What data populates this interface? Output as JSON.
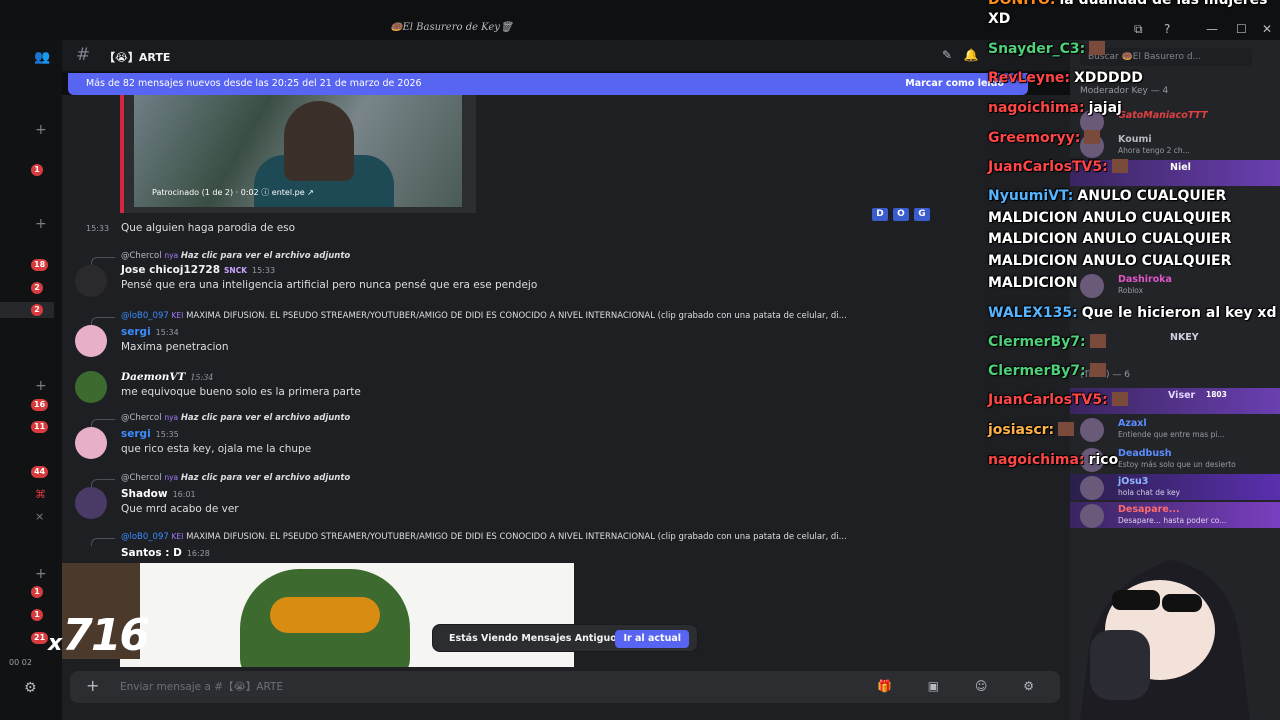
{
  "window": {
    "title": "🍩El Basurero de Key🗑",
    "controls": [
      "⧉",
      "?",
      "—",
      "☐",
      "✕"
    ]
  },
  "server_rail": {
    "badges": [
      "1",
      "18",
      "2",
      "2",
      "16",
      "11",
      "44",
      "1",
      "1",
      "21"
    ],
    "time_tag": "00  02"
  },
  "channel": {
    "name": "【😭】ARTE"
  },
  "new_messages_banner": {
    "text": "Más de 82 mensajes nuevos desde las 20:25 del 21 de marzo de 2026",
    "mark_read": "Marcar como leído"
  },
  "embed": {
    "caption": "Patrocinado (1 de 2) · 0:02  ⓘ  entel.pe ↗"
  },
  "hover_toolbar": [
    "D",
    "O",
    "G"
  ],
  "messages": [
    {
      "time": "15:33",
      "text": "Que alguien haga parodia de eso"
    },
    {
      "reply_name": "@Chercol",
      "reply_tag": "nya",
      "reply_text": "Haz clic para ver el archivo adjunto",
      "author": "Jose chicoj12728",
      "author_tag": "SNCK",
      "time": "15:33",
      "text": "Pensé que era una inteligencia artificial pero nunca pensé que era ese pendejo"
    },
    {
      "reply_name": "@loB0_097",
      "reply_tag": "KEI",
      "reply_text": "MAXIMA DIFUSION. EL PSEUDO STREAMER/YOUTUBER/AMIGO DE DIDI ES CONOCIDO A NIVEL INTERNACIONAL (clip grabado con una patata de celular, di...",
      "author": "sergi",
      "time": "15:34",
      "text": "Maxima penetracion"
    },
    {
      "author": "DaemonVT",
      "time": "15:34",
      "text": "me equivoque bueno solo es la primera parte"
    },
    {
      "reply_name": "@Chercol",
      "reply_tag": "nya",
      "reply_text": "Haz clic para ver el archivo adjunto",
      "author": "sergi",
      "time": "15:35",
      "text": "que rico esta key, ojala me la chupe"
    },
    {
      "reply_name": "@Chercol",
      "reply_tag": "nya",
      "reply_text": "Haz clic para ver el archivo adjunto",
      "author": "Shadow",
      "time": "16:01",
      "text": "Que mrd acabo de ver"
    },
    {
      "reply_name": "@loB0_097",
      "reply_tag": "KEI",
      "reply_text": "MAXIMA DIFUSION. EL PSEUDO STREAMER/YOUTUBER/AMIGO DE DIDI ES CONOCIDO A NIVEL INTERNACIONAL (clip grabado con una patata de celular, di...",
      "author": "Santos : D",
      "time": "16:28",
      "text": ""
    }
  ],
  "overlay_counter": {
    "x": "x",
    "value": "716"
  },
  "jump_pill": {
    "label": "Estás Viendo Mensajes Antiguos",
    "button": "Ir al actual"
  },
  "composer": {
    "placeholder": "Enviar mensaje a #【😭】ARTE"
  },
  "member_list": {
    "search_placeholder": "Buscar 🍩El Basurero d...",
    "header_mod": "Moderador Key — 4",
    "header_tier": "(Tier I) — 6",
    "members": [
      {
        "name": "GatoManiacoTTT",
        "status": ""
      },
      {
        "name": "Koumi",
        "status": "Ahora tengo 2 ch..."
      },
      {
        "name": "Niel",
        "status": ""
      },
      {
        "name": "Dashiroka",
        "status": "Roblox"
      },
      {
        "name": "NKEY",
        "status": ""
      },
      {
        "name": "Viser",
        "status": "1803"
      },
      {
        "name": "Azaxl",
        "status": "Entiende que entre mas pi..."
      },
      {
        "name": "Deadbush",
        "status": "Estoy más solo que un desierto"
      },
      {
        "name": "jOsu3",
        "status": "hola chat de key"
      },
      {
        "name": "Desapare...",
        "status": "Desapare... hasta poder co..."
      }
    ]
  },
  "stream_chat": [
    {
      "user": "DONITO:",
      "text": "la dualidad de las mujeres",
      "color": "#ff8c1a"
    },
    {
      "user": "",
      "text": "XD",
      "color": "#ffffff"
    },
    {
      "user": "Snayder_C3:",
      "text": "",
      "color": "#4fd17a"
    },
    {
      "user": "RevLeyne:",
      "text": "XDDDDD",
      "color": "#ff4646"
    },
    {
      "user": "nagoichima:",
      "text": "jajaj",
      "color": "#ff4646"
    },
    {
      "user": "Greemoryy:",
      "text": "",
      "color": "#ff4646"
    },
    {
      "user": "JuanCarlosTV5:",
      "text": "",
      "color": "#ff4646"
    },
    {
      "user": "NyuumiVT:",
      "text": "ANULO CUALQUIER",
      "color": "#55b3ff"
    },
    {
      "user": "",
      "text": "MALDICION ANULO CUALQUIER",
      "color": "#ffffff"
    },
    {
      "user": "",
      "text": "MALDICION ANULO CUALQUIER",
      "color": "#ffffff"
    },
    {
      "user": "",
      "text": "MALDICION ANULO CUALQUIER",
      "color": "#ffffff"
    },
    {
      "user": "",
      "text": "MALDICION",
      "color": "#ffffff"
    },
    {
      "user": "WALEX135:",
      "text": "Que le hicieron al key xd",
      "color": "#55b3ff"
    },
    {
      "user": "ClermerBy7:",
      "text": "",
      "color": "#4fd17a"
    },
    {
      "user": "ClermerBy7:",
      "text": "",
      "color": "#4fd17a"
    },
    {
      "user": "JuanCarlosTV5:",
      "text": "",
      "color": "#ff4646"
    },
    {
      "user": "josiascr:",
      "text": "",
      "color": "#ffb347"
    },
    {
      "user": "nagoichima:",
      "text": "rico",
      "color": "#ff4646"
    }
  ],
  "colors": {
    "accent": "#5865f2",
    "badge": "#d83c3e",
    "sergi": "#3b8cff",
    "daemon": "#ffffff"
  }
}
